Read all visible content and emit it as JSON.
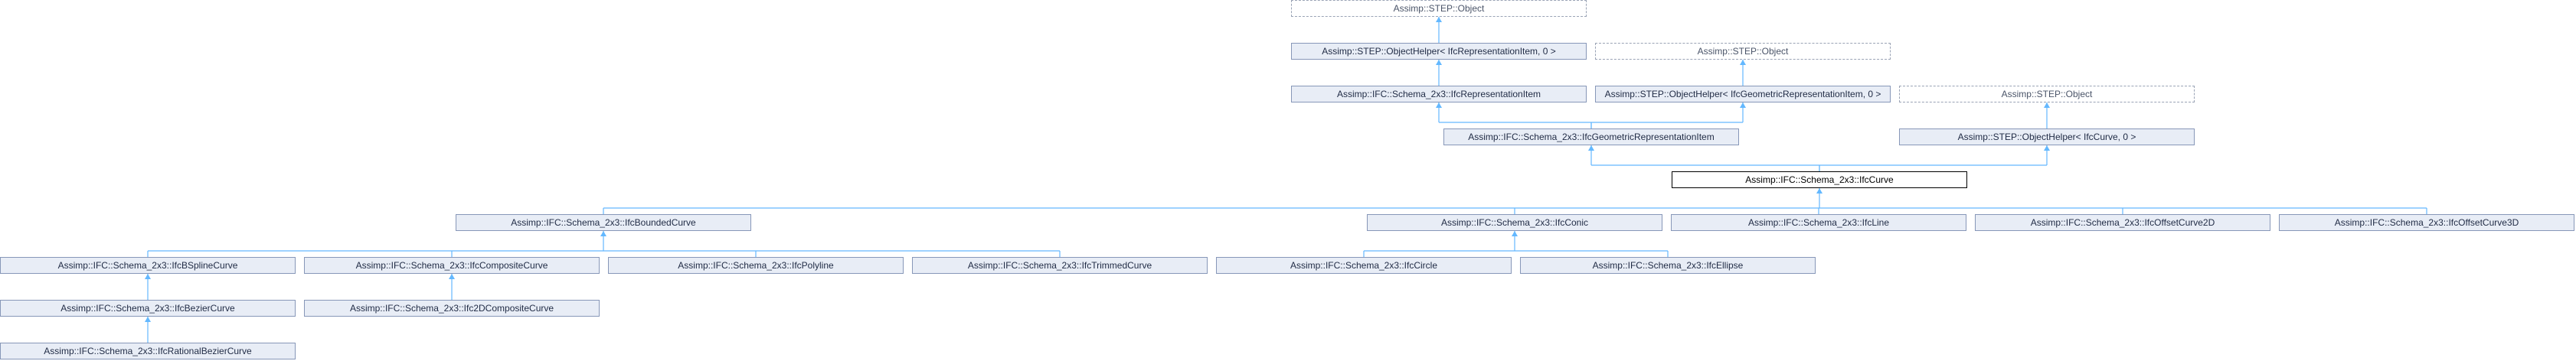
{
  "nodes": [
    {
      "id": "n1",
      "label": "Assimp::STEP::Object",
      "style": "dashed"
    },
    {
      "id": "n2",
      "label": "Assimp::STEP::ObjectHelper< IfcRepresentationItem, 0 >",
      "style": "normal"
    },
    {
      "id": "n3",
      "label": "Assimp::STEP::Object",
      "style": "dashed"
    },
    {
      "id": "n4",
      "label": "Assimp::IFC::Schema_2x3::IfcRepresentationItem",
      "style": "normal"
    },
    {
      "id": "n5",
      "label": "Assimp::STEP::ObjectHelper< IfcGeometricRepresentationItem, 0 >",
      "style": "normal"
    },
    {
      "id": "n6",
      "label": "Assimp::STEP::Object",
      "style": "dashed"
    },
    {
      "id": "n7",
      "label": "Assimp::IFC::Schema_2x3::IfcGeometricRepresentationItem",
      "style": "normal"
    },
    {
      "id": "n8",
      "label": "Assimp::STEP::ObjectHelper< IfcCurve, 0 >",
      "style": "normal"
    },
    {
      "id": "n9",
      "label": "Assimp::IFC::Schema_2x3::IfcCurve",
      "style": "focus"
    },
    {
      "id": "n10",
      "label": "Assimp::IFC::Schema_2x3::IfcBoundedCurve",
      "style": "normal"
    },
    {
      "id": "n11",
      "label": "Assimp::IFC::Schema_2x3::IfcConic",
      "style": "normal"
    },
    {
      "id": "n12",
      "label": "Assimp::IFC::Schema_2x3::IfcLine",
      "style": "normal"
    },
    {
      "id": "n13",
      "label": "Assimp::IFC::Schema_2x3::IfcOffsetCurve2D",
      "style": "normal"
    },
    {
      "id": "n14",
      "label": "Assimp::IFC::Schema_2x3::IfcOffsetCurve3D",
      "style": "normal"
    },
    {
      "id": "n15",
      "label": "Assimp::IFC::Schema_2x3::IfcBSplineCurve",
      "style": "normal"
    },
    {
      "id": "n16",
      "label": "Assimp::IFC::Schema_2x3::IfcCompositeCurve",
      "style": "normal"
    },
    {
      "id": "n17",
      "label": "Assimp::IFC::Schema_2x3::IfcPolyline",
      "style": "normal"
    },
    {
      "id": "n18",
      "label": "Assimp::IFC::Schema_2x3::IfcTrimmedCurve",
      "style": "normal"
    },
    {
      "id": "n19",
      "label": "Assimp::IFC::Schema_2x3::IfcCircle",
      "style": "normal"
    },
    {
      "id": "n20",
      "label": "Assimp::IFC::Schema_2x3::IfcEllipse",
      "style": "normal"
    },
    {
      "id": "n21",
      "label": "Assimp::IFC::Schema_2x3::IfcBezierCurve",
      "style": "normal"
    },
    {
      "id": "n22",
      "label": "Assimp::IFC::Schema_2x3::Ifc2DCompositeCurve",
      "style": "normal"
    },
    {
      "id": "n23",
      "label": "Assimp::IFC::Schema_2x3::IfcRationalBezierCurve",
      "style": "normal"
    }
  ],
  "edges": [
    {
      "parent": "n1",
      "children": [
        "n2"
      ]
    },
    {
      "parent": "n2",
      "children": [
        "n4"
      ]
    },
    {
      "parent": "n3",
      "children": [
        "n5"
      ]
    },
    {
      "parent": "n4",
      "children": [
        "n7"
      ]
    },
    {
      "parent": "n5",
      "children": [
        "n7"
      ]
    },
    {
      "parent": "n6",
      "children": [
        "n8"
      ]
    },
    {
      "parent": "n7",
      "children": [
        "n9"
      ]
    },
    {
      "parent": "n8",
      "children": [
        "n9"
      ]
    },
    {
      "parent": "n9",
      "children": [
        "n10",
        "n11",
        "n12",
        "n13",
        "n14"
      ]
    },
    {
      "parent": "n10",
      "children": [
        "n15",
        "n16",
        "n17",
        "n18"
      ]
    },
    {
      "parent": "n11",
      "children": [
        "n19",
        "n20"
      ]
    },
    {
      "parent": "n15",
      "children": [
        "n21"
      ]
    },
    {
      "parent": "n16",
      "children": [
        "n22"
      ]
    },
    {
      "parent": "n21",
      "children": [
        "n23"
      ]
    }
  ],
  "colors": {
    "edge": "#63b8ff",
    "node_fill": "#e8edf6",
    "node_border": "#8797b8"
  }
}
